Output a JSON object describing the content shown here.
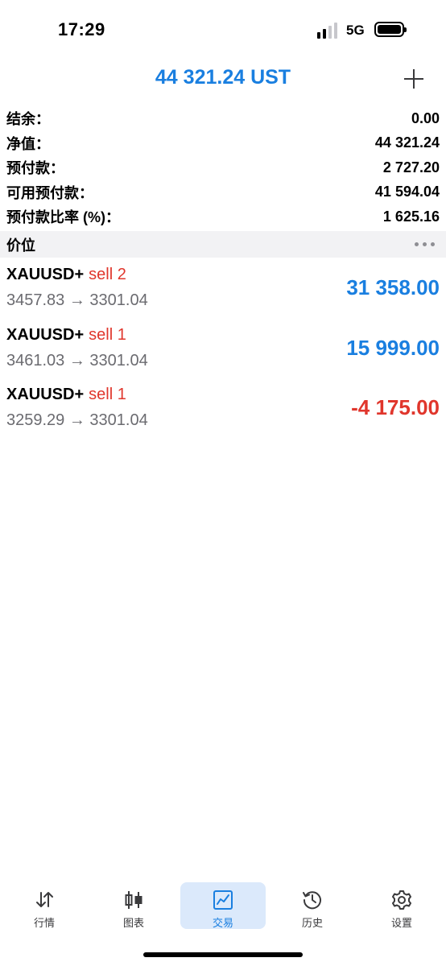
{
  "status_bar": {
    "time": "17:29",
    "network": "5G",
    "icons": [
      "signal-icon",
      "battery-icon"
    ]
  },
  "header": {
    "title": "44 321.24 UST",
    "add_icon": "plus-icon"
  },
  "summary": [
    {
      "label": "结余：",
      "value": "0.00"
    },
    {
      "label": "净值：",
      "value": "44 321.24"
    },
    {
      "label": "预付款：",
      "value": "2 727.20"
    },
    {
      "label": "可用预付款：",
      "value": "41 594.04"
    },
    {
      "label": "预付款比率 (%)：",
      "value": "1 625.16"
    }
  ],
  "section": {
    "title": "价位",
    "more_icon": "more-horizontal-icon"
  },
  "positions": [
    {
      "symbol": "XAUUSD+",
      "side": "sell 2",
      "prices": "3457.83 → 3301.04",
      "profit": "31 358.00",
      "profit_color": "#1a7fe0"
    },
    {
      "symbol": "XAUUSD+",
      "side": "sell 1",
      "prices": "3461.03 → 3301.04",
      "profit": "15 999.00",
      "profit_color": "#1a7fe0"
    },
    {
      "symbol": "XAUUSD+",
      "side": "sell 1",
      "prices": "3259.29 → 3301.04",
      "profit": "-4 175.00",
      "profit_color": "#e0362c"
    }
  ],
  "tabs": [
    {
      "label": "行情",
      "icon": "quotes-arrows-icon",
      "active": false
    },
    {
      "label": "图表",
      "icon": "candlestick-chart-icon",
      "active": false
    },
    {
      "label": "交易",
      "icon": "trade-chart-icon",
      "active": true
    },
    {
      "label": "历史",
      "icon": "history-clock-icon",
      "active": false
    },
    {
      "label": "设置",
      "icon": "gear-icon",
      "active": false
    }
  ],
  "colors": {
    "accent": "#1a7fe0",
    "loss": "#e0362c",
    "active_tab_bg": "#dbe9fb",
    "section_bg": "#f2f2f4"
  }
}
